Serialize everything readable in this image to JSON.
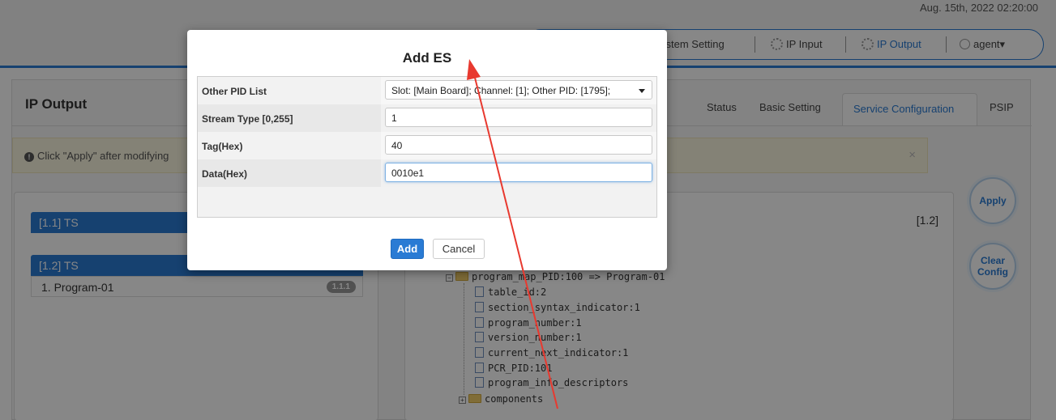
{
  "header": {
    "datetime": "Aug. 15th, 2022 02:20:00",
    "nav": {
      "system_setting": "ystem Setting",
      "ip_input": "IP Input",
      "ip_output": "IP Output",
      "user": "agent",
      "user_caret": "▾"
    }
  },
  "page": {
    "title": "IP Output",
    "tabs": [
      "Status",
      "Basic Setting",
      "Service Configuration",
      "PSIP"
    ],
    "alert": "Click \"Apply\" after modifying",
    "alert_icon": "!",
    "alert_close": "×"
  },
  "left_panel": {
    "ts_items": [
      "[1.1] TS",
      "[1.2] TS"
    ],
    "program": {
      "label": "1. Program-01",
      "badge": "1.1.1"
    }
  },
  "right_panel": {
    "label": "[1.2]",
    "tree": {
      "root": "program_map_PID:100 => Program-01",
      "root_toggle": "−",
      "children": [
        "table_id:2",
        "section_syntax_indicator:1",
        "program_number:1",
        "version_number:1",
        "current_next_indicator:1",
        "PCR_PID:101",
        "program_info_descriptors"
      ],
      "folder": "components",
      "folder_toggle": "+"
    }
  },
  "side_buttons": {
    "apply": "Apply",
    "clear_config": "Clear Config"
  },
  "modal": {
    "title": "Add ES",
    "fields": [
      {
        "label": "Other PID List",
        "value": "Slot: [Main Board]; Channel: [1]; Other PID: [1795];"
      },
      {
        "label": "Stream Type [0,255]",
        "value": "1"
      },
      {
        "label": "Tag(Hex)",
        "value": "40"
      },
      {
        "label": "Data(Hex)",
        "value": "0010e1"
      }
    ],
    "add_label": "Add",
    "cancel_label": "Cancel"
  },
  "colors": {
    "accent": "#2a7bd4",
    "annotation_arrow": "#e8392f"
  }
}
